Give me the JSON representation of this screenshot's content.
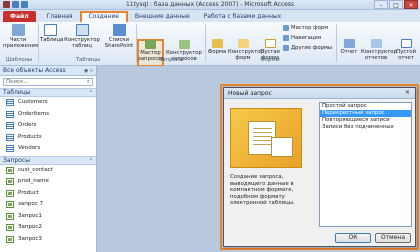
{
  "window": {
    "title": "11tysql : база данных (Access 2007) - Microsoft Access",
    "controls": [
      "–",
      "□",
      "✕"
    ]
  },
  "tabs": {
    "file": "Файл",
    "home": "Главная",
    "create": "Создание",
    "external": "Внешние данные",
    "database_tools": "Работа с базами данных"
  },
  "ribbon": {
    "app_parts": "Части приложения",
    "table": "Таблица",
    "table_design": "Конструктор таблиц",
    "sharepoint_lists": "Списки SharePoint",
    "query_wizard": "Мастер запросов",
    "query_design": "Конструктор запросов",
    "form": "Форма",
    "form_design": "Конструктор форм",
    "blank_form": "Пустая форма",
    "form_wizard": "Мастер форм",
    "navigation": "Навигация",
    "more_forms": "Другие формы",
    "report": "Отчет",
    "report_design": "Конструктор отчетов",
    "blank_report": "Пустой отчет",
    "groups": {
      "templates": "Шаблоны",
      "tables": "Таблицы",
      "queries": "Запросы",
      "forms": "Формы"
    }
  },
  "nav": {
    "header": "Все объекты Access",
    "search_placeholder": "Поиск...",
    "tables_section": "Таблицы",
    "tables": [
      "Customers",
      "OrderItems",
      "Orders",
      "Products",
      "Vendors"
    ],
    "queries_section": "Запросы",
    "queries": [
      "cust_contact",
      "prod_name",
      "Product",
      "запрос 7",
      "Запрос1",
      "Запрос2",
      "Запрос3"
    ]
  },
  "dialog": {
    "title": "Новый запрос",
    "description": "Создание запроса, выводящего данные в компактном формате, подобном формату электронной таблицы.",
    "options": [
      "Простой запрос",
      "Перекрестный запрос",
      "Повторяющиеся записи",
      "Записи без подчиненных"
    ],
    "selected_index": 1,
    "ok": "ОК",
    "cancel": "Отмена"
  },
  "colors": {
    "highlight": "#e8842d",
    "file_tab": "#c8302c",
    "selection": "#3399ff"
  }
}
